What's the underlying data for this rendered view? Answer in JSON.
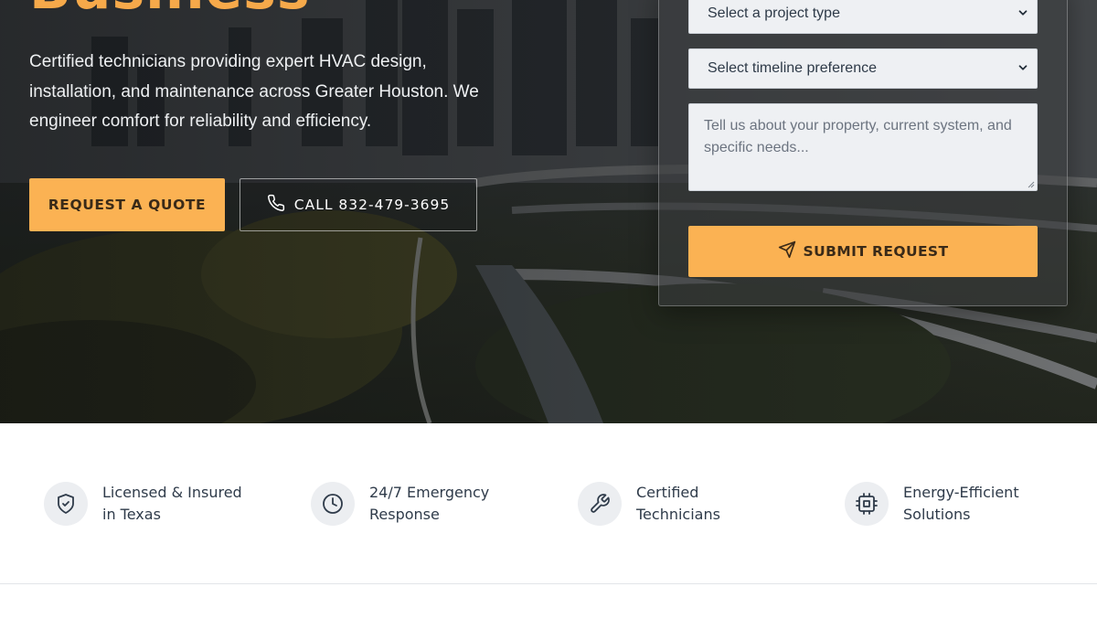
{
  "hero": {
    "title": "Business",
    "description": "Certified technicians providing expert HVAC design, installation, and maintenance across Greater Houston. We engineer comfort for reliability and efficiency.",
    "quote_button_label": "REQUEST A QUOTE",
    "call_button_label": "CALL 832-479-3695",
    "call_icon": "phone-icon"
  },
  "form": {
    "project_type_selected": "Select a project type",
    "timeline_selected": "Select timeline preference",
    "details_placeholder": "Tell us about your property, current system, and specific needs...",
    "submit_label": "SUBMIT REQUEST",
    "submit_icon": "send-icon"
  },
  "features": [
    {
      "icon": "shield-check-icon",
      "line1": "Licensed & Insured",
      "line2": "in Texas"
    },
    {
      "icon": "clock-icon",
      "line1": "24/7 Emergency",
      "line2": "Response"
    },
    {
      "icon": "wrench-icon",
      "line1": "Certified",
      "line2": "Technicians"
    },
    {
      "icon": "chip-icon",
      "line1": "Energy-Efficient",
      "line2": "Solutions"
    }
  ],
  "colors": {
    "accent": "#fbb253",
    "title_accent": "#f6a94a",
    "text_dark": "#2f3b4a",
    "icon_bg": "#eceef1"
  }
}
